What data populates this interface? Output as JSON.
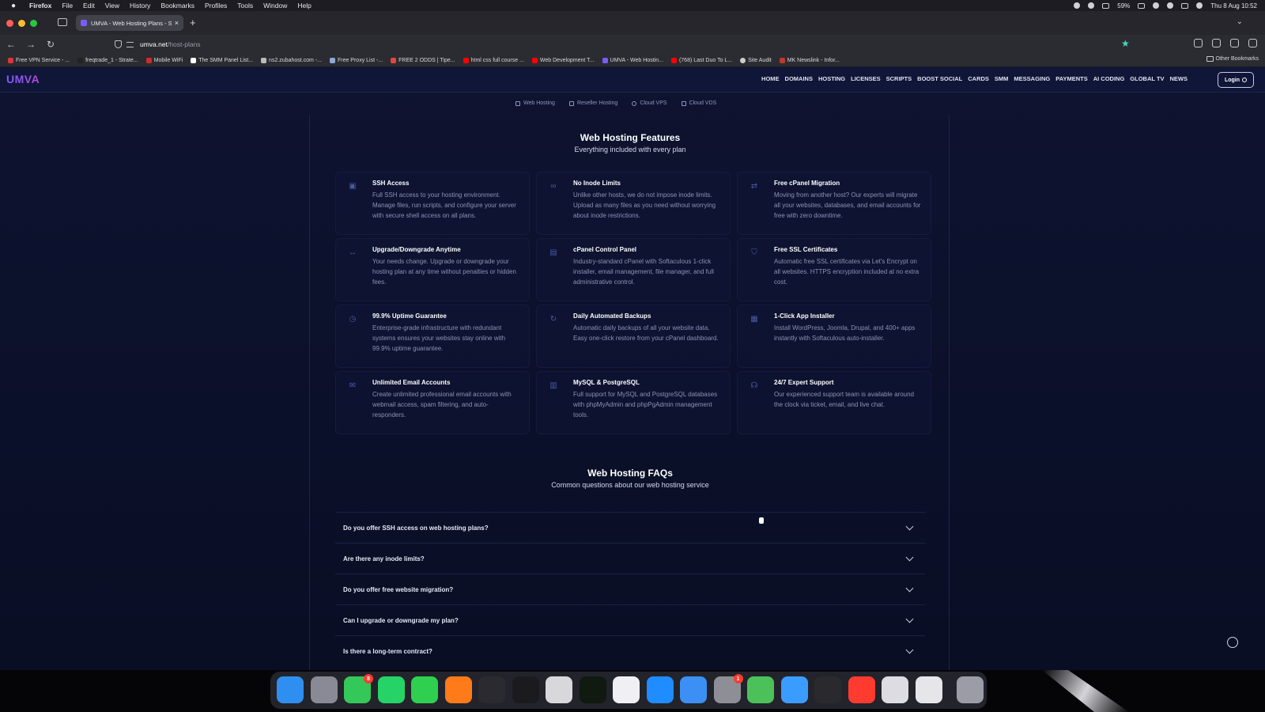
{
  "menubar": {
    "app": "Firefox",
    "items": [
      "File",
      "Edit",
      "View",
      "History",
      "Bookmarks",
      "Profiles",
      "Tools",
      "Window",
      "Help"
    ],
    "battery": "59%",
    "datetime": "Thu 8 Aug  10:52"
  },
  "browser": {
    "tab_title": "UMVA - Web Hosting Plans - S",
    "url_host": "umva.net",
    "url_path": "/host-plans",
    "bookmarks": [
      "Free VPN Service - ...",
      "freqtrade_1 - Strate...",
      "Mobile WiFi",
      "The SMM Panel List...",
      "ns2.zubahost.com -...",
      "Free Proxy List -...",
      "FREE 2 ODDS | Tipe...",
      "html css full course ...",
      "Web Development T...",
      "UMVA - Web Hostin...",
      "(768) Last Duo To L...",
      "Site Audit",
      "MK Newslink - Infor..."
    ],
    "other_bookmarks": "Other Bookmarks"
  },
  "site": {
    "logo": "UMVA",
    "nav": [
      "HOME",
      "DOMAINS",
      "HOSTING",
      "LICENSES",
      "SCRIPTS",
      "BOOST SOCIAL",
      "CARDS",
      "SMM",
      "MESSAGING",
      "PAYMENTS",
      "AI CODING",
      "GLOBAL TV",
      "NEWS"
    ],
    "login_label": "Login",
    "subtabs": [
      "Web Hosting",
      "Reseller Hosting",
      "Cloud VPS",
      "Cloud VDS"
    ]
  },
  "features": {
    "title": "Web Hosting Features",
    "subtitle": "Everything included with every plan",
    "items": [
      {
        "icon": "terminal-icon",
        "title": "SSH Access",
        "desc": "Full SSH access to your hosting environment. Manage files, run scripts, and configure your server with secure shell access on all plans."
      },
      {
        "icon": "infinity-icon",
        "title": "No Inode Limits",
        "desc": "Unlike other hosts, we do not impose inode limits. Upload as many files as you need without worrying about inode restrictions."
      },
      {
        "icon": "exchange-icon",
        "title": "Free cPanel Migration",
        "desc": "Moving from another host? Our experts will migrate all your websites, databases, and email accounts for free with zero downtime."
      },
      {
        "icon": "arrows-horizontal-icon",
        "title": "Upgrade/Downgrade Anytime",
        "desc": "Your needs change. Upgrade or downgrade your hosting plan at any time without penalties or hidden fees."
      },
      {
        "icon": "control-panel-icon",
        "title": "cPanel Control Panel",
        "desc": "Industry-standard cPanel with Softaculous 1-click installer, email management, file manager, and full administrative control."
      },
      {
        "icon": "shield-icon",
        "title": "Free SSL Certificates",
        "desc": "Automatic free SSL certificates via Let's Encrypt on all websites. HTTPS encryption included at no extra cost."
      },
      {
        "icon": "clock-icon",
        "title": "99.9% Uptime Guarantee",
        "desc": "Enterprise-grade infrastructure with redundant systems ensures your websites stay online with 99.9% uptime guarantee."
      },
      {
        "icon": "refresh-icon",
        "title": "Daily Automated Backups",
        "desc": "Automatic daily backups of all your website data. Easy one-click restore from your cPanel dashboard."
      },
      {
        "icon": "app-installer-icon",
        "title": "1-Click App Installer",
        "desc": "Install WordPress, Joomla, Drupal, and 400+ apps instantly with Softaculous auto-installer."
      },
      {
        "icon": "mail-icon",
        "title": "Unlimited Email Accounts",
        "desc": "Create unlimited professional email accounts with webmail access, spam filtering, and auto-responders."
      },
      {
        "icon": "database-icon",
        "title": "MySQL & PostgreSQL",
        "desc": "Full support for MySQL and PostgreSQL databases with phpMyAdmin and phpPgAdmin management tools."
      },
      {
        "icon": "headset-icon",
        "title": "24/7 Expert Support",
        "desc": "Our experienced support team is available around the clock via ticket, email, and live chat."
      }
    ]
  },
  "faqs": {
    "title": "Web Hosting FAQs",
    "subtitle": "Common questions about our web hosting service",
    "items": [
      "Do you offer SSH access on web hosting plans?",
      "Are there any inode limits?",
      "Do you offer free website migration?",
      "Can I upgrade or downgrade my plan?",
      "Is there a long-term contract?"
    ]
  },
  "dock": {
    "apps": [
      {
        "name": "finder-icon",
        "color": "#2f8ff0"
      },
      {
        "name": "launchpad-icon",
        "color": "#8a8a96"
      },
      {
        "name": "messages-icon",
        "color": "#34c759",
        "badge": "8"
      },
      {
        "name": "whatsapp-icon",
        "color": "#25d366"
      },
      {
        "name": "facetime-icon",
        "color": "#2fcf4f"
      },
      {
        "name": "firefox-icon",
        "color": "#ff7a18"
      },
      {
        "name": "chatgpt-icon",
        "color": "#2a2a30"
      },
      {
        "name": "terminal-icon",
        "color": "#1b1b1f"
      },
      {
        "name": "textedit-icon",
        "color": "#d8d8dc"
      },
      {
        "name": "activity-icon",
        "color": "#101a10"
      },
      {
        "name": "unity-icon",
        "color": "#f0f0f4"
      },
      {
        "name": "app-store-icon",
        "color": "#1f8cff"
      },
      {
        "name": "xcode-icon",
        "color": "#3b8ff5"
      },
      {
        "name": "system-settings-icon",
        "color": "#8e8e96",
        "badge": "1"
      },
      {
        "name": "parrot-icon",
        "color": "#4cc15a"
      },
      {
        "name": "mail-app-icon",
        "color": "#3b9cff"
      },
      {
        "name": "piano-icon",
        "color": "#2a2a2e"
      },
      {
        "name": "media-player-icon",
        "color": "#ff3b30"
      },
      {
        "name": "blank-app-icon",
        "color": "#dcdce2"
      },
      {
        "name": "blank-app-2-icon",
        "color": "#e6e6ea"
      },
      {
        "name": "trash-icon",
        "color": "#9c9ca6"
      }
    ]
  }
}
